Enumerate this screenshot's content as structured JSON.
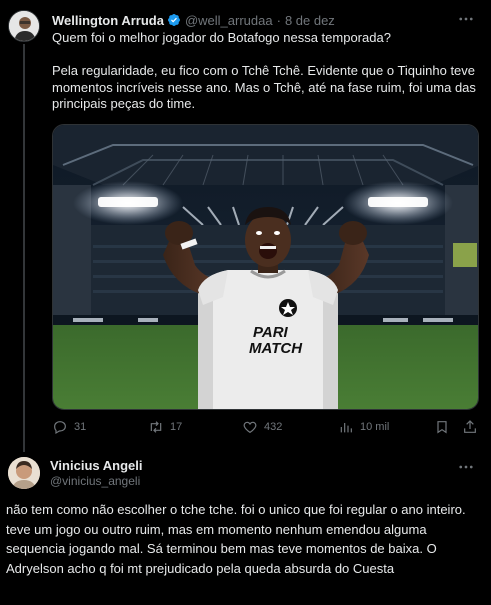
{
  "tweet1": {
    "author_name": "Wellington Arruda",
    "author_handle": "@well_arrudaa",
    "separator": "·",
    "date": "8 de dez",
    "text_line1": "Quem foi o melhor jogador do Botafogo nessa temporada?",
    "text_para2": "Pela regularidade, eu fico com o Tchê Tchê. Evidente que o Tiquinho teve momentos incríveis nesse ano. Mas o Tchê, até na fase ruim, foi uma das principais peças do time.",
    "jersey_sponsor_line1": "PARI",
    "jersey_sponsor_line2": "MATCH",
    "actions": {
      "replies": "31",
      "retweets": "17",
      "likes": "432",
      "views": "10 mil"
    }
  },
  "tweet2": {
    "author_name": "Vinicius Angeli",
    "author_handle": "@vinicius_angeli",
    "text": "não tem como não escolher o tche tche. foi o unico que foi regular o ano inteiro. teve um jogo ou outro ruim, mas em momento nenhum emendou alguma sequencia jogando mal. Sá terminou bem mas teve momentos de baixa. O Adryelson acho q foi mt prejudicado pela queda absurda do Cuesta"
  },
  "colors": {
    "background": "#000000",
    "text": "#e7e9ea",
    "muted": "#71767b",
    "verified": "#1d9bf0",
    "border": "#2f3336"
  },
  "icons": [
    "verified-badge-icon",
    "more-icon",
    "reply-icon",
    "retweet-icon",
    "like-icon",
    "views-icon",
    "bookmark-icon",
    "share-icon"
  ]
}
